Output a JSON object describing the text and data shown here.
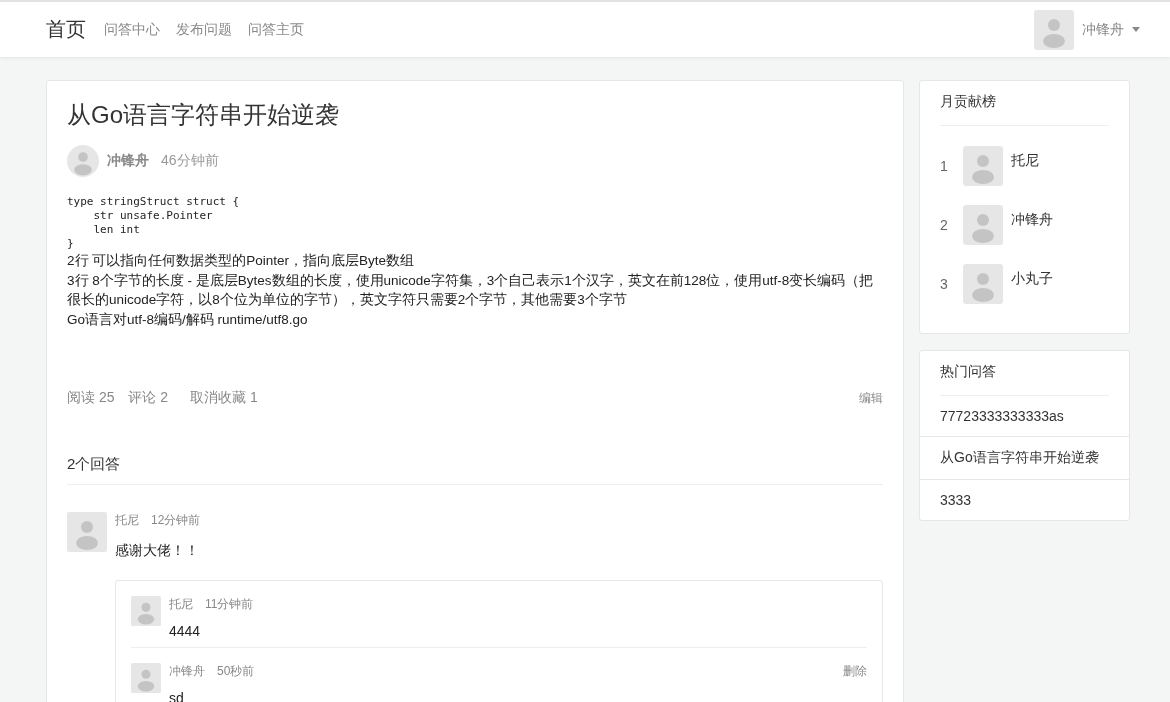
{
  "nav": {
    "brand": "首页",
    "links": [
      "问答中心",
      "发布问题",
      "问答主页"
    ],
    "user": "冲锋舟"
  },
  "post": {
    "title": "从Go语言字符串开始逆袭",
    "author": "冲锋舟",
    "time": "46分钟前",
    "code": [
      "type stringStruct struct {",
      "    str unsafe.Pointer",
      "    len int",
      "}"
    ],
    "paragraphs": [
      "2行 可以指向任何数据类型的Pointer，指向底层Byte数组",
      "3行 8个字节的长度 - 是底层Bytes数组的长度，使用unicode字符集，3个自己表示1个汉字，英文在前128位，使用utf-8变长编码（把很长的unicode字符，以8个位为单位的字节），英文字符只需要2个字节，其他需要3个字节",
      "Go语言对utf-8编码/解码 runtime/utf8.go"
    ],
    "stats": [
      "阅读 25",
      "评论 2",
      "取消收藏 1"
    ],
    "edit": "编辑"
  },
  "answers_title": "2个回答",
  "answers": [
    {
      "author": "托尼",
      "time": "12分钟前",
      "body": "感谢大佬！！",
      "replies": [
        {
          "author": "托尼",
          "time": "11分钟前",
          "body": "4444"
        },
        {
          "author": "冲锋舟",
          "time": "50秒前",
          "body": "sd",
          "delete": "删除"
        }
      ]
    }
  ],
  "ranking": {
    "title": "月贡献榜",
    "items": [
      {
        "rank": "1",
        "name": "托尼"
      },
      {
        "rank": "2",
        "name": "冲锋舟"
      },
      {
        "rank": "3",
        "name": "小丸子"
      }
    ]
  },
  "hot": {
    "title": "热门问答",
    "items": [
      "77723333333333as",
      "从Go语言字符串开始逆袭",
      "3333"
    ]
  }
}
